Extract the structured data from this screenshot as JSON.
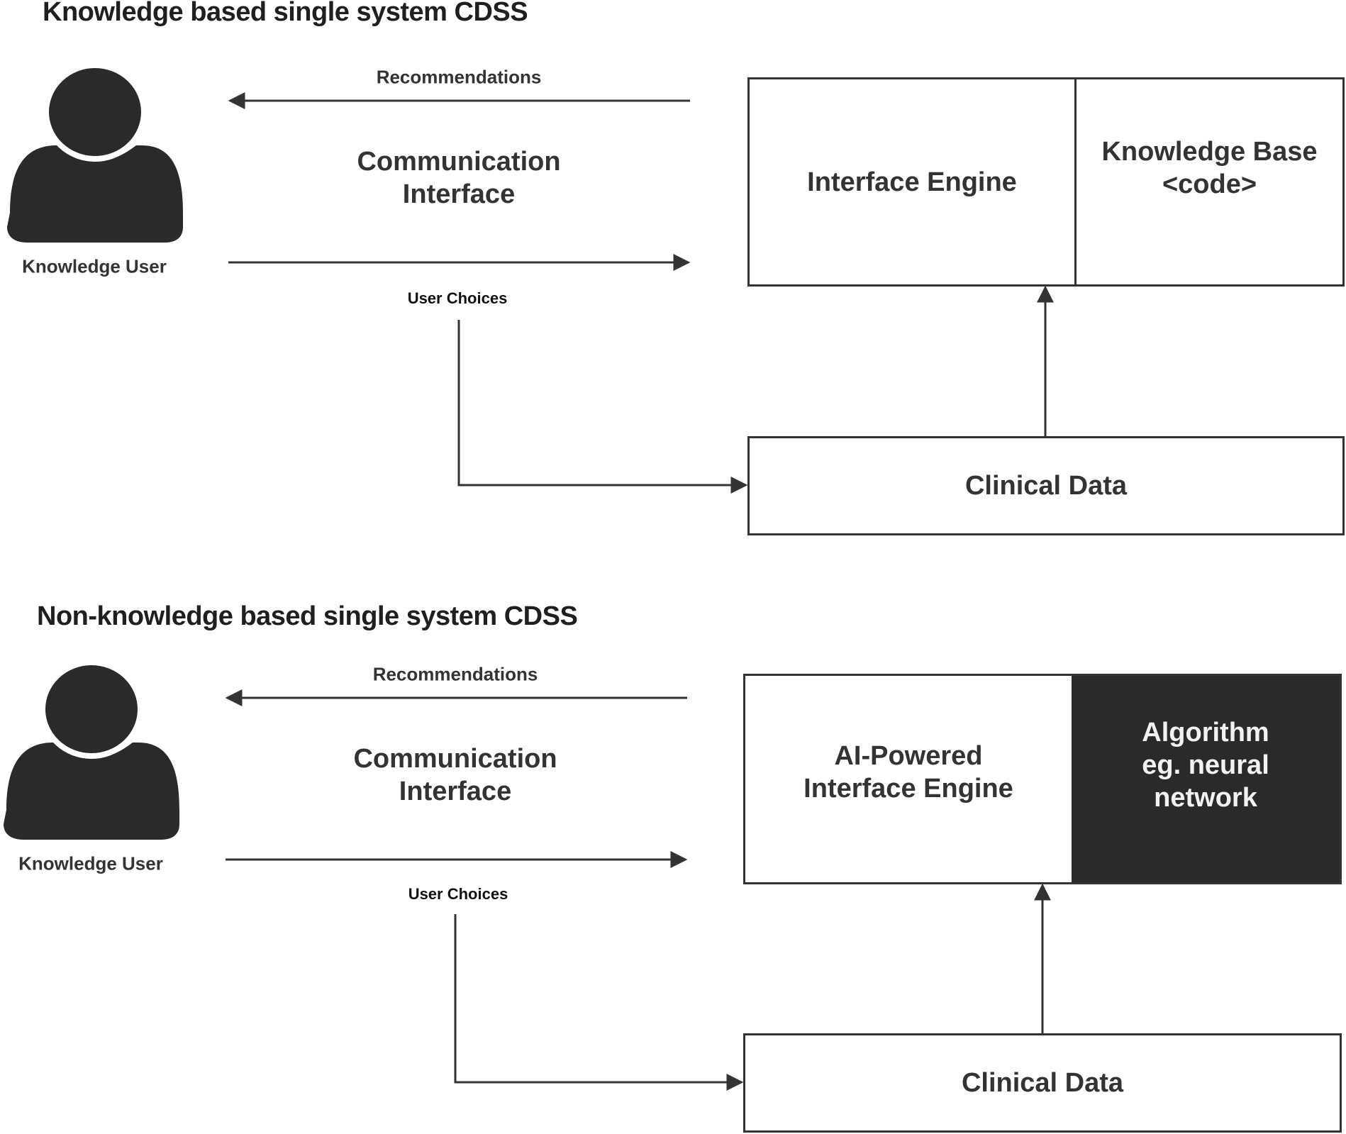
{
  "diagrams": [
    {
      "title": "Knowledge based single system CDSS",
      "user": {
        "icon": "person-icon",
        "label": "Knowledge User"
      },
      "recommendations_label": "Recommendations",
      "communication_interface": [
        "Communication",
        "Interface"
      ],
      "user_choices_label": "User Choices",
      "engine_box": {
        "left": [
          "Interface Engine"
        ],
        "right": [
          "Knowledge Base",
          "<code>"
        ],
        "right_style": "light"
      },
      "clinical_data_label": "Clinical Data"
    },
    {
      "title": "Non-knowledge based single system CDSS",
      "user": {
        "icon": "person-icon",
        "label": "Knowledge User"
      },
      "recommendations_label": "Recommendations",
      "communication_interface": [
        "Communication",
        "Interface"
      ],
      "user_choices_label": "User Choices",
      "engine_box": {
        "left": [
          "AI-Powered",
          "Interface Engine"
        ],
        "right": [
          "Algorithm",
          "eg. neural",
          "network"
        ],
        "right_style": "dark"
      },
      "clinical_data_label": "Clinical Data"
    }
  ],
  "colors": {
    "stroke": "#333333",
    "dark_fill": "#2b2a2a",
    "text": "#333333"
  }
}
